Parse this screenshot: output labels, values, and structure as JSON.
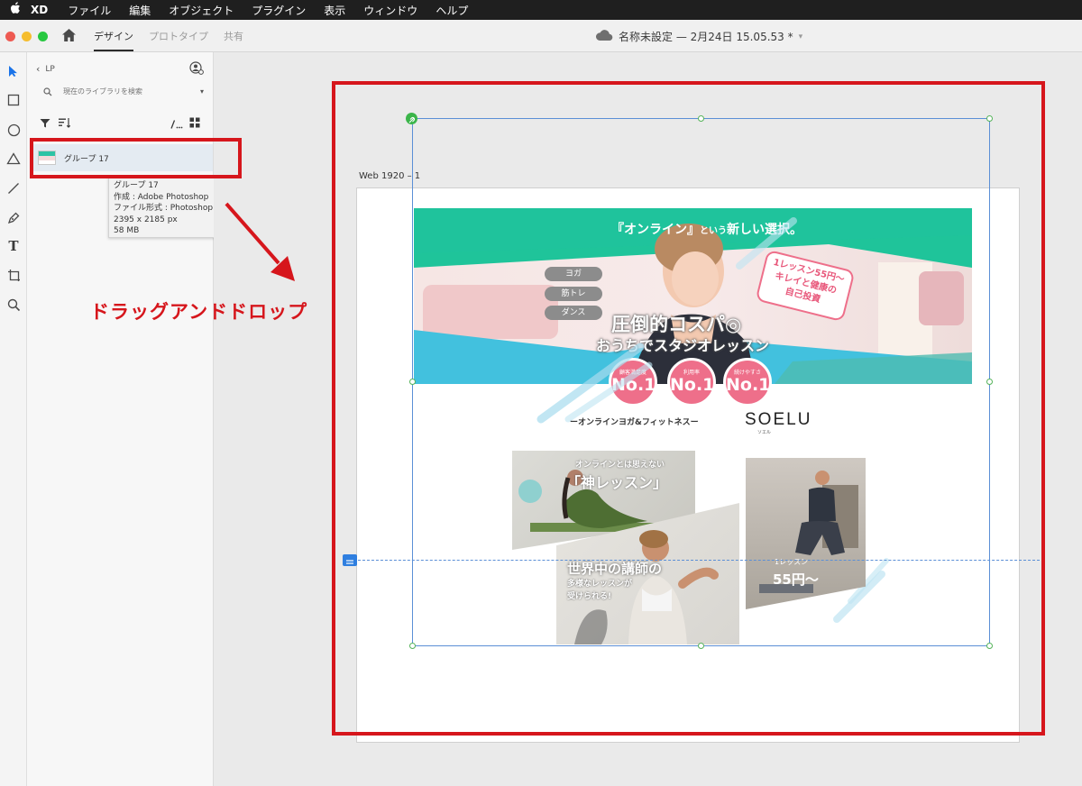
{
  "menubar": {
    "app": "XD",
    "items": [
      "ファイル",
      "編集",
      "オブジェクト",
      "プラグイン",
      "表示",
      "ウィンドウ",
      "ヘルプ"
    ]
  },
  "titlebar": {
    "tabs": [
      "デザイン",
      "プロトタイプ",
      "共有"
    ],
    "active_tab": "デザイン",
    "doc_title": "名称未設定 — 2月24日 15.05.53 *"
  },
  "tools": [
    "select-icon",
    "rectangle-icon",
    "ellipse-icon",
    "polygon-icon",
    "line-icon",
    "pen-icon",
    "text-icon",
    "artboard-icon",
    "zoom-icon"
  ],
  "library": {
    "back_label": "LP",
    "search_placeholder": "現在のライブラリを検索",
    "item_name": "グループ 17",
    "tooltip": {
      "name": "グループ 17",
      "author": "作成 : Adobe Photoshop",
      "format": "ファイル形式 : Photoshop",
      "dimensions": "2395 x 2185 px",
      "size": "58 MB"
    }
  },
  "annotation": {
    "drag_label": "ドラッグアンドドロップ",
    "accent": "#d6161c"
  },
  "canvas": {
    "artboard_label": "Web 1920 – 1"
  },
  "banner": {
    "headline_main": "『オンライン』",
    "headline_small": "という",
    "headline_tail": "新しい選択。",
    "pills": [
      "ヨガ",
      "筋トレ",
      "ダンス"
    ],
    "callout": [
      "1レッスン55円〜",
      "キレイと健康の",
      "自己投資"
    ],
    "copy1": "圧倒的コスパ◎",
    "copy2": "おうちでスタジオレッスン",
    "medals": [
      {
        "caption": "顧客満足度",
        "rank": "No.1"
      },
      {
        "caption": "利用率",
        "rank": "No.1"
      },
      {
        "caption": "続けやすさ",
        "rank": "No.1"
      }
    ]
  },
  "brand": {
    "tagline": "ーオンラインヨガ&フィットネスー",
    "logo": "SOELU",
    "logo_kana": "ソエル"
  },
  "tiles": {
    "yoga_small": "オンラインとは思えない",
    "yoga_big": "「神レッスン」",
    "teacher_big": "世界中の講師の",
    "teacher_small1": "多様なレッスンが",
    "teacher_small2": "受けられる!",
    "price_small": "1レッスン",
    "price_big": "55円〜"
  },
  "colors": {
    "selection": "#5b8fd6",
    "banner_green": "#1fc49a",
    "banner_blue": "#3fc0dd",
    "medal_pink": "#ee6f8a"
  }
}
